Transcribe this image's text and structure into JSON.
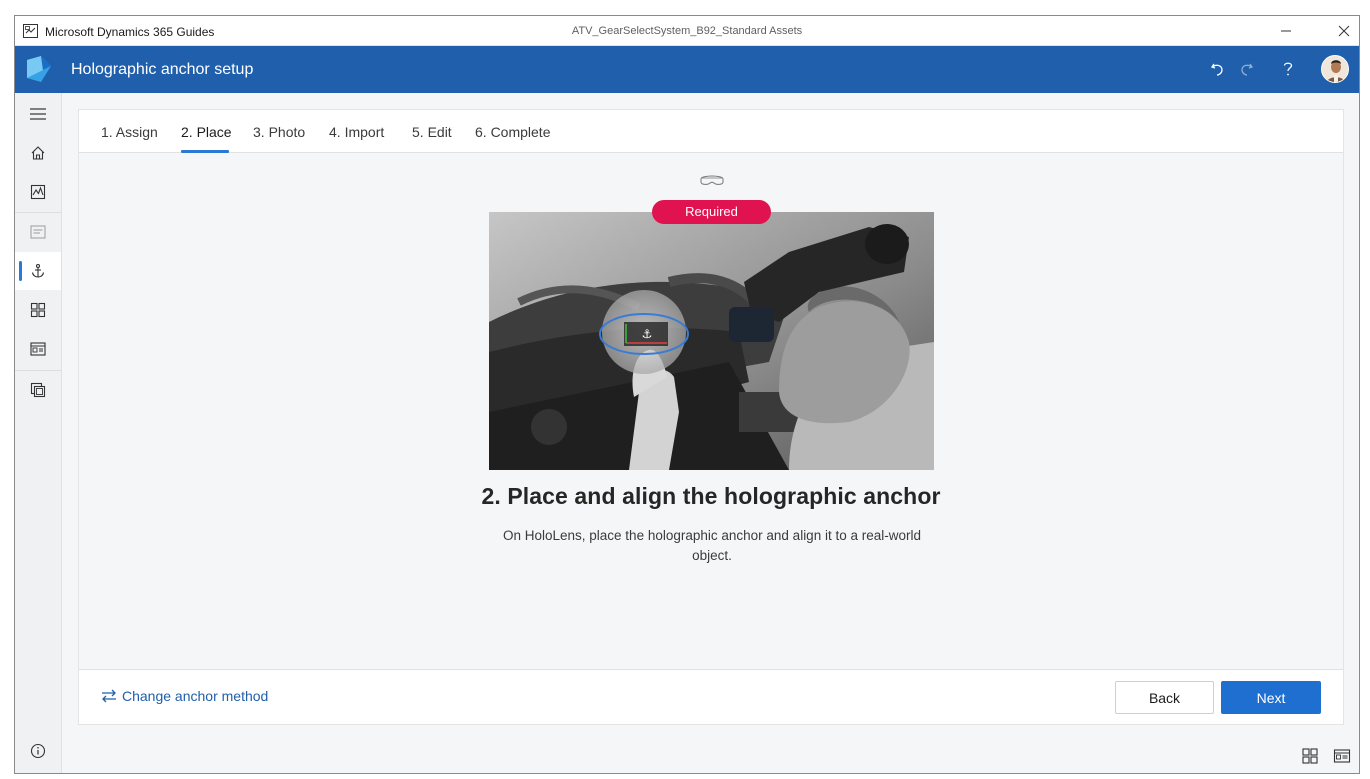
{
  "window": {
    "app_name": "Microsoft Dynamics 365 Guides",
    "document_name": "ATV_GearSelectSystem_B92_Standard Assets",
    "controls": [
      "minimize-icon",
      "close-icon"
    ]
  },
  "header": {
    "title": "Holographic anchor setup",
    "icons": [
      "undo-icon",
      "redo-icon",
      "help-icon",
      "avatar"
    ],
    "color": "#1f5fab"
  },
  "rail": {
    "items": [
      {
        "icon": "hamburger-menu-icon"
      },
      {
        "icon": "home-icon"
      },
      {
        "icon": "analytics-icon"
      },
      {
        "icon": "outline-icon"
      },
      {
        "icon": "anchor-icon",
        "active": true
      },
      {
        "icon": "grid-icon"
      },
      {
        "icon": "step-card-icon"
      },
      {
        "icon": "gallery-icon"
      },
      {
        "icon": "info-icon"
      }
    ]
  },
  "tabs": [
    {
      "label": "1. Assign"
    },
    {
      "label": "2. Place",
      "active": true
    },
    {
      "label": "3. Photo"
    },
    {
      "label": "4. Import"
    },
    {
      "label": "5. Edit"
    },
    {
      "label": "6. Complete"
    }
  ],
  "content": {
    "device_icon": "hololens-icon",
    "badge": "Required",
    "badge_color": "#e0124f",
    "heading": "2. Place and align the holographic anchor",
    "description": "On HoloLens, place the holographic anchor and align it to a real-world object."
  },
  "footer": {
    "change_anchor_label": "Change anchor method",
    "back_label": "Back",
    "next_label": "Next",
    "accent": "#1f6fd1"
  },
  "statusbar": {
    "icons": [
      "grid-view-icon",
      "card-view-icon"
    ]
  }
}
